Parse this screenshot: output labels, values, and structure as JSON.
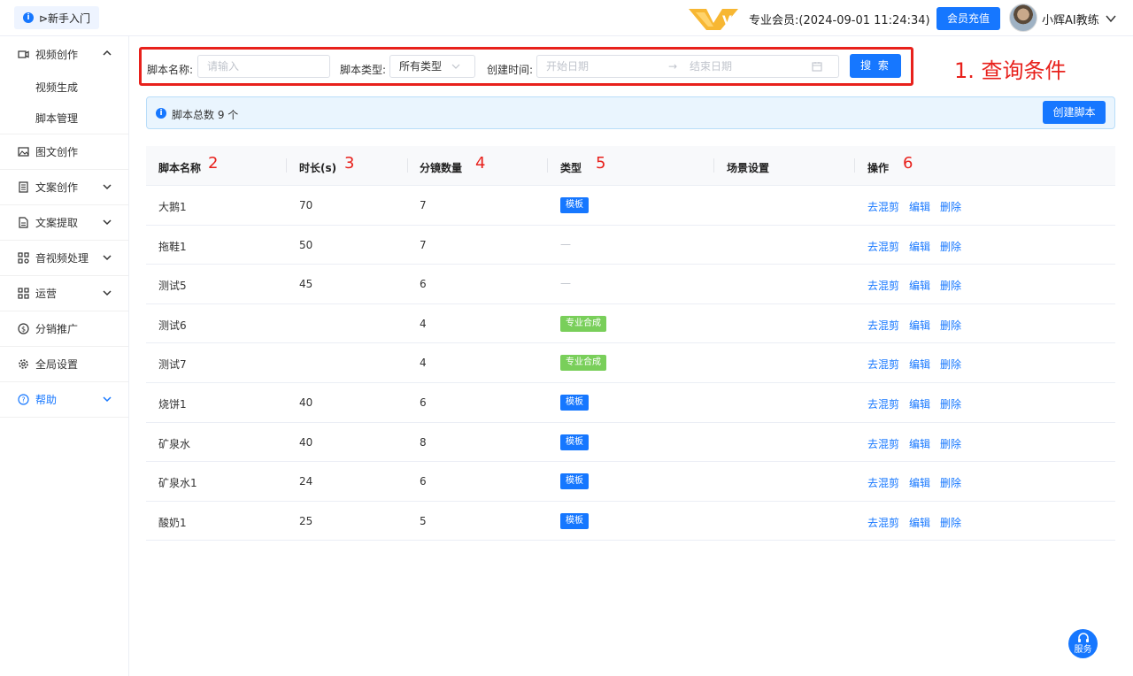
{
  "header": {
    "guide_label": "⊳新手入门",
    "vip_badge": "V4",
    "membership_text": "专业会员:(2024-09-01 11:24:34)",
    "recharge_label": "会员充值",
    "username": "小辉AI教练"
  },
  "sidebar": {
    "items": [
      {
        "label": "视频创作",
        "icon": "video-icon",
        "expanded": true,
        "children": [
          "视频生成",
          "脚本管理"
        ]
      },
      {
        "label": "图文创作",
        "icon": "image-icon"
      },
      {
        "label": "文案创作",
        "icon": "document-icon"
      },
      {
        "label": "文案提取",
        "icon": "file-extract-icon"
      },
      {
        "label": "音视频处理",
        "icon": "media-process-icon"
      },
      {
        "label": "运营",
        "icon": "grid-icon"
      },
      {
        "label": "分销推广",
        "icon": "dollar-icon"
      },
      {
        "label": "全局设置",
        "icon": "gear-icon"
      },
      {
        "label": "帮助",
        "icon": "help-icon"
      }
    ]
  },
  "filters": {
    "name_label": "脚本名称:",
    "name_placeholder": "请输入",
    "type_label": "脚本类型:",
    "type_value": "所有类型",
    "date_label": "创建时间:",
    "start_placeholder": "开始日期",
    "end_placeholder": "结束日期",
    "search_label": "搜 索"
  },
  "annotation": {
    "title": "1. 查询条件",
    "col_numbers": [
      "2",
      "3",
      "4",
      "5",
      "6"
    ]
  },
  "alert": {
    "text": "脚本总数 9 个",
    "create_label": "创建脚本"
  },
  "table": {
    "headers": [
      "脚本名称",
      "时长(s)",
      "分镜数量",
      "类型",
      "场景设置",
      "操作"
    ],
    "actions": [
      "去混剪",
      "编辑",
      "删除"
    ],
    "rows": [
      {
        "name": "大鹅1",
        "duration": "70",
        "shots": "7",
        "type": "模板"
      },
      {
        "name": "拖鞋1",
        "duration": "50",
        "shots": "7",
        "type": ""
      },
      {
        "name": "测试5",
        "duration": "45",
        "shots": "6",
        "type": ""
      },
      {
        "name": "测试6",
        "duration": "",
        "shots": "4",
        "type": "专业合成"
      },
      {
        "name": "测试7",
        "duration": "",
        "shots": "4",
        "type": "专业合成"
      },
      {
        "name": "烧饼1",
        "duration": "40",
        "shots": "6",
        "type": "模板"
      },
      {
        "name": "矿泉水",
        "duration": "40",
        "shots": "8",
        "type": "模板"
      },
      {
        "name": "矿泉水1",
        "duration": "24",
        "shots": "6",
        "type": "模板"
      },
      {
        "name": "酸奶1",
        "duration": "25",
        "shots": "5",
        "type": "模板"
      }
    ],
    "empty_placeholder": "—"
  },
  "service": {
    "label": "服务"
  },
  "colors": {
    "primary": "#1677ff",
    "annotation": "#e8211c",
    "tag_green": "#79cf5a"
  }
}
